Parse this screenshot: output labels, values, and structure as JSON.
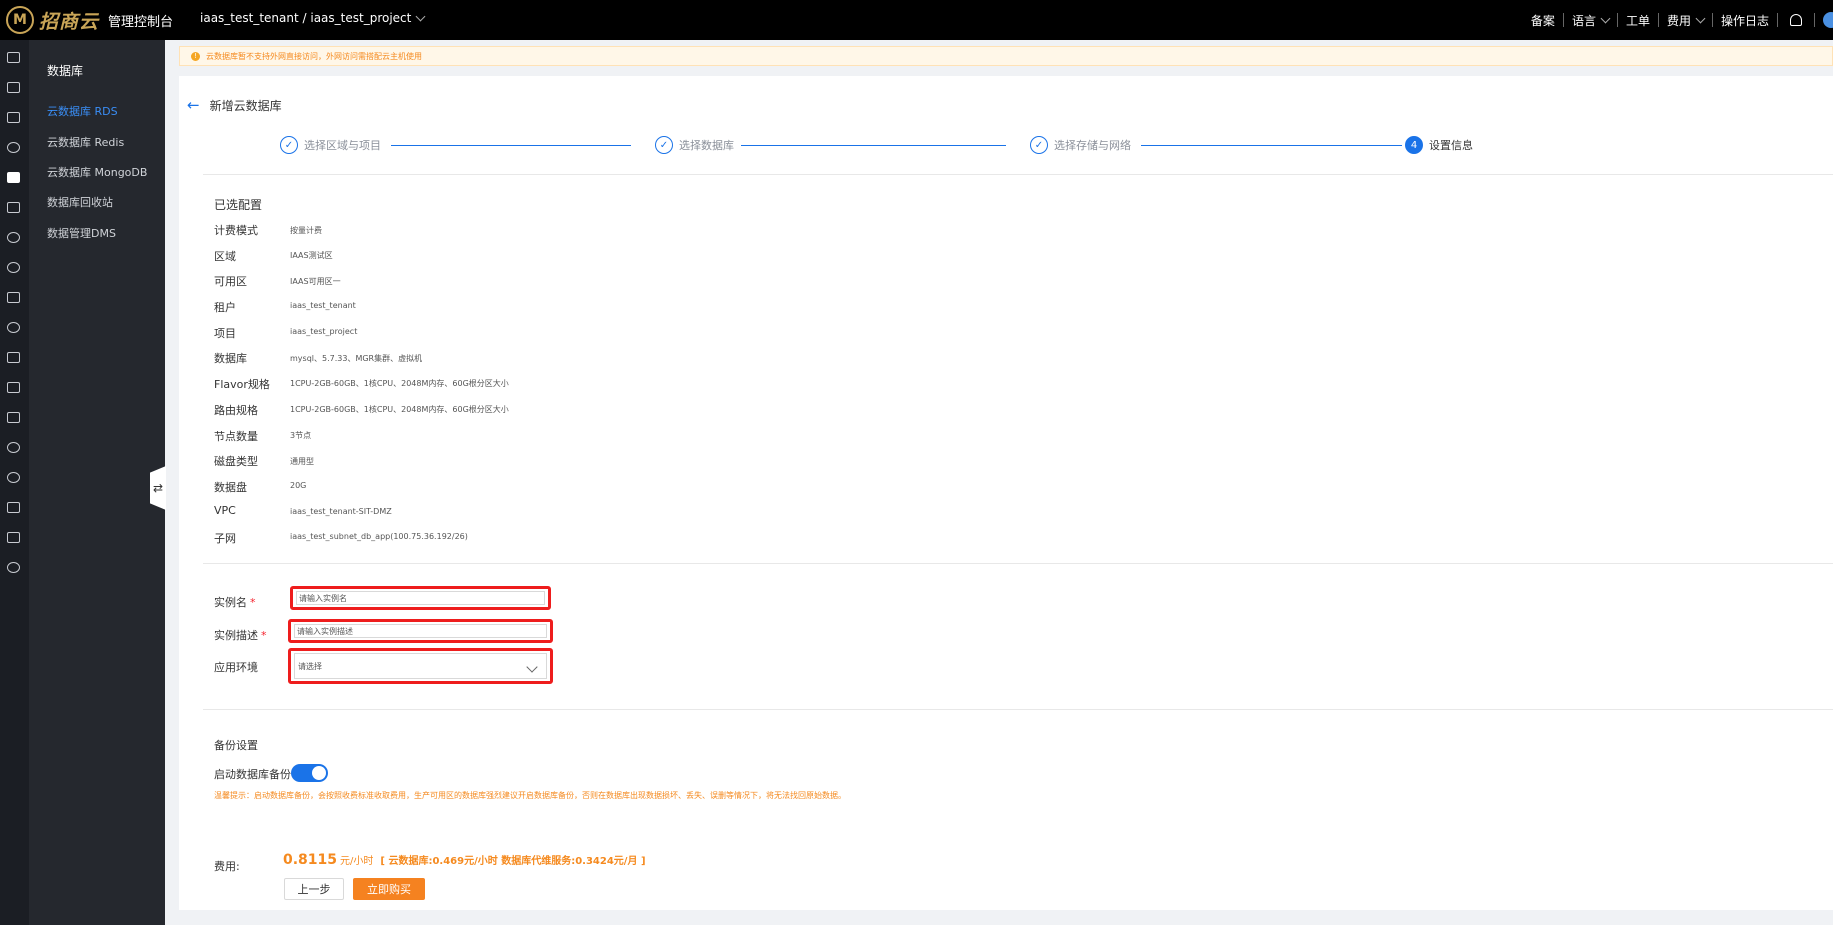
{
  "topbar": {
    "logo_text": "招商云",
    "console_title": "管理控制台",
    "project": "iaas_test_tenant / iaas_test_project",
    "right_items": [
      "备案",
      "语言",
      "工单",
      "费用",
      "操作日志"
    ]
  },
  "subnav": {
    "title": "数据库",
    "items": [
      "云数据库 RDS",
      "云数据库 Redis",
      "云数据库 MongoDB",
      "数据库回收站",
      "数据管理DMS"
    ]
  },
  "notice": "云数据库暂不支持外网直接访问，外网访问需搭配云主机使用",
  "page": {
    "title": "新增云数据库"
  },
  "steps": [
    {
      "label": "选择区域与项目",
      "marker": "✓"
    },
    {
      "label": "选择数据库",
      "marker": "✓"
    },
    {
      "label": "选择存储与网络",
      "marker": "✓"
    },
    {
      "label": "设置信息",
      "marker": "4"
    }
  ],
  "config": {
    "title": "已选配置",
    "rows": [
      {
        "label": "计费模式",
        "value": "按量计费"
      },
      {
        "label": "区域",
        "value": "IAAS测试区"
      },
      {
        "label": "可用区",
        "value": "IAAS可用区一"
      },
      {
        "label": "租户",
        "value": "iaas_test_tenant"
      },
      {
        "label": "项目",
        "value": "iaas_test_project"
      },
      {
        "label": "数据库",
        "value": "mysql、5.7.33、MGR集群、虚拟机"
      },
      {
        "label": "Flavor规格",
        "value": "1CPU-2GB-60GB、1核CPU、2048M内存、60G根分区大小"
      },
      {
        "label": "路由规格",
        "value": "1CPU-2GB-60GB、1核CPU、2048M内存、60G根分区大小"
      },
      {
        "label": "节点数量",
        "value": "3节点"
      },
      {
        "label": "磁盘类型",
        "value": "通用型"
      },
      {
        "label": "数据盘",
        "value": "20G"
      },
      {
        "label": "VPC",
        "value": "iaas_test_tenant-SIT-DMZ"
      },
      {
        "label": "子网",
        "value": "iaas_test_subnet_db_app(100.75.36.192/26)"
      }
    ]
  },
  "form": {
    "instance_name_label": "实例名",
    "instance_name_placeholder": "请输入实例名",
    "instance_desc_label": "实例描述",
    "instance_desc_placeholder": "请输入实例描述",
    "env_label": "应用环境",
    "env_placeholder": "请选择",
    "required_mark": "*"
  },
  "backup": {
    "title": "备份设置",
    "toggle_label": "启动数据库备份",
    "enabled": true,
    "warning": "温馨提示：启动数据库备份，会按照收费标准收取费用，生产可用区的数据库强烈建议开启数据库备份，否则在数据库出现数据损坏、丢失、误删等情况下，将无法找回原始数据。"
  },
  "fee": {
    "label": "费用:",
    "amount": "0.8115",
    "unit": "元/小时",
    "detail": "[ 云数据库:0.469元/小时 数据库代维服务:0.3424元/月 ]",
    "prev_button": "上一步",
    "buy_button": "立即购买"
  },
  "colors": {
    "primary": "#1a73e8",
    "accent": "#f58220",
    "highlight": "#ee1d1d"
  }
}
